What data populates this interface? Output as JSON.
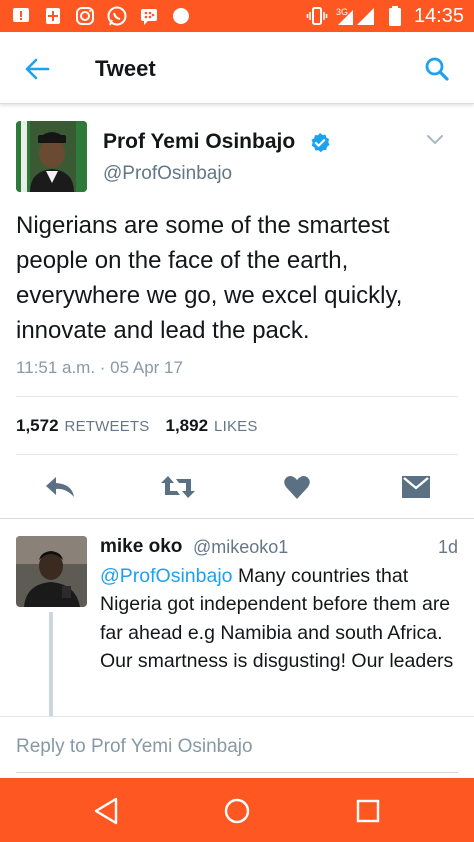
{
  "status_bar": {
    "time": "14:35",
    "network": "3G",
    "icons": [
      "notification-icon",
      "plus-icon",
      "instagram-icon",
      "whatsapp-icon",
      "bbm-icon",
      "circle-icon",
      "vibrate-icon",
      "signal-icon",
      "battery-icon"
    ]
  },
  "header": {
    "title": "Tweet",
    "back_icon": "arrow-left-icon",
    "search_icon": "search-icon"
  },
  "tweet": {
    "author_name": "Prof Yemi Osinbajo",
    "author_handle": "@ProfOsinbajo",
    "verified": true,
    "text": "Nigerians are some of the smartest people on the face of the earth, everywhere we go, we excel quickly, innovate and lead the pack.",
    "timestamp": "11:51 a.m. · 05 Apr 17",
    "retweets_count": "1,572",
    "retweets_label": "RETWEETS",
    "likes_count": "1,892",
    "likes_label": "LIKES"
  },
  "actions": [
    "reply-icon",
    "retweet-icon",
    "like-icon",
    "dm-icon"
  ],
  "reply": {
    "author_name": "mike oko",
    "author_handle": "@mikeoko1",
    "time": "1d",
    "mention": "@ProfOsinbajo",
    "text": " Many countries that Nigeria got independent before them are far ahead e.g Namibia and south Africa. Our smartness is disgusting! Our leaders"
  },
  "reply_box": {
    "placeholder": "Reply to Prof Yemi Osinbajo"
  },
  "colors": {
    "status_bar": "#ff5722",
    "accent": "#1da1f2",
    "secondary_text": "#657786",
    "icon_gray": "#5b7083"
  }
}
